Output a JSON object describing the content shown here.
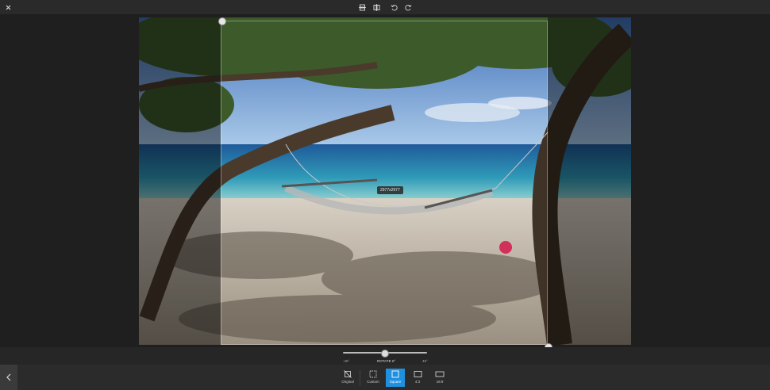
{
  "toolbar": {
    "close_icon": "close-icon",
    "icons": [
      "flip-vertical-icon",
      "flip-horizontal-icon",
      "rotate-left-icon",
      "rotate-right-icon"
    ]
  },
  "crop": {
    "dimensions_label": "2977x2977"
  },
  "rotation": {
    "min_label": "-45°",
    "center_label": "ROTATE 0°",
    "max_label": "45°",
    "value_fraction": 0.5
  },
  "aspect_ratios": [
    {
      "label": "Original",
      "selected": false
    },
    {
      "label": "Custom",
      "selected": false
    },
    {
      "label": "Square",
      "selected": true
    },
    {
      "label": "4:3",
      "selected": false
    },
    {
      "label": "16:9",
      "selected": false
    }
  ],
  "colors": {
    "accent": "#1f8fe0",
    "background": "#1f1f1f"
  }
}
